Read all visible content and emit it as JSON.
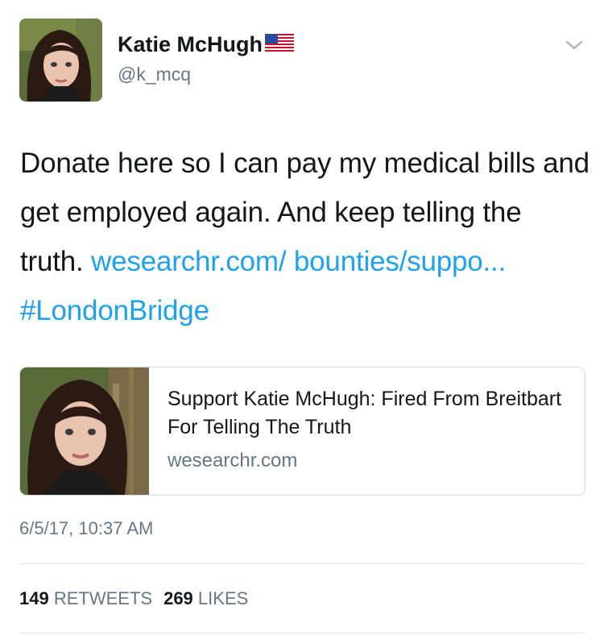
{
  "user": {
    "name": "Katie McHugh",
    "handle": "@k_mcq",
    "flag_icon": "us-flag-icon"
  },
  "tweet": {
    "text_plain": "Donate here so I can pay my medical bills and get employed again. And keep telling the truth.",
    "link_text": "wesearchr.com/ bounties/suppo...",
    "hashtag": "#LondonBridge",
    "timestamp": "6/5/17, 10:37 AM"
  },
  "card": {
    "title": "Support Katie McHugh: Fired From Breitbart For Telling The Truth",
    "domain": "wesearchr.com"
  },
  "stats": {
    "retweets_count": "149",
    "retweets_label": "RETWEETS",
    "likes_count": "269",
    "likes_label": "LIKES"
  },
  "colors": {
    "link": "#1da1f2",
    "secondary_text": "#657786",
    "primary_text": "#14171a",
    "divider": "#dfe4e8"
  }
}
